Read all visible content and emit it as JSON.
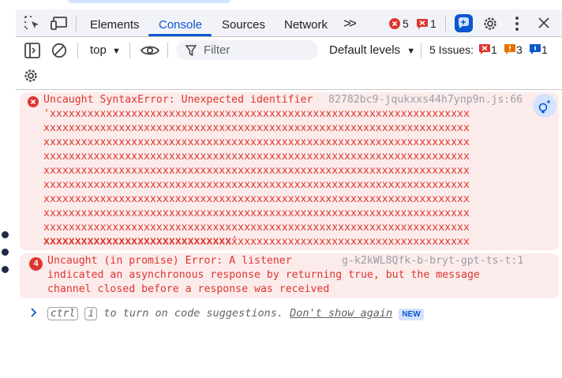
{
  "tabs": {
    "elements": "Elements",
    "console": "Console",
    "sources": "Sources",
    "network": "Network",
    "more": ">>"
  },
  "badges": {
    "errors": "5",
    "warnings": "1"
  },
  "toolbar": {
    "context": "top",
    "filter_placeholder": "Filter",
    "levels": "Default levels",
    "issues_label": "5 Issues:",
    "issues_errors": "1",
    "issues_warnings": "3",
    "issues_info": "1"
  },
  "messages": [
    {
      "text": "Uncaught SyntaxError: Unexpected identifier",
      "source": "82782bc9-jqukxxs44h7ynp9n.js:66",
      "lines": [
        "'xxxxxxxxxxxxxxxxxxxxxxxxxxxxxxxxxxxxxxxxxxxxxxxxxxxxxxxxxxxxxxxxxxx",
        "xxxxxxxxxxxxxxxxxxxxxxxxxxxxxxxxxxxxxxxxxxxxxxxxxxxxxxxxxxxxxxxxxxxx",
        "xxxxxxxxxxxxxxxxxxxxxxxxxxxxxxxxxxxxxxxxxxxxxxxxxxxxxxxxxxxxxxxxxxxx",
        "xxxxxxxxxxxxxxxxxxxxxxxxxxxxxxxxxxxxxxxxxxxxxxxxxxxxxxxxxxxxxxxxxxxx",
        "xxxxxxxxxxxxxxxxxxxxxxxxxxxxxxxxxxxxxxxxxxxxxxxxxxxxxxxxxxxxxxxxxxxx",
        "xxxxxxxxxxxxxxxxxxxxxxxxxxxxxxxxxxxxxxxxxxxxxxxxxxxxxxxxxxxxxxxxxxxx",
        "xxxxxxxxxxxxxxxxxxxxxxxxxxxxxxxxxxxxxxxxxxxxxxxxxxxxxxxxxxxxxxxxxxxx",
        "xxxxxxxxxxxxxxxxxxxxxxxxxxxxxxxxxxxxxxxxxxxxxxxxxxxxxxxxxxxxxxxxxxxx",
        "xxxxxxxxxxxxxxxxxxxxxxxxxxxxxxxxxxxxxxxxxxxxxxxxxxxxxxxxxxxxxxxxxxxx",
        "xxxxxxxxxxxxxxxxxxxxxxxxxxxxxxxxxxxxxxxxxxxxxxxxxxxxxxxxxxxxxxxxxxxx",
        "xxxxxxxxxxxxxxxxxxxxxxxxxxxxxx'"
      ]
    },
    {
      "count": "4",
      "text": "Uncaught (in promise) Error: A listener",
      "source": "g-k2kWL8Qfk-b-bryt-gpt-ts-t:1",
      "lines": [
        "indicated an asynchronous response by returning true, but the message",
        "channel closed before a response was received"
      ]
    }
  ],
  "prompt_hint": {
    "ctrl": "ctrl",
    "key": "i",
    "text": "to turn on code suggestions.",
    "link": "Don't show again",
    "new_badge": "NEW"
  }
}
